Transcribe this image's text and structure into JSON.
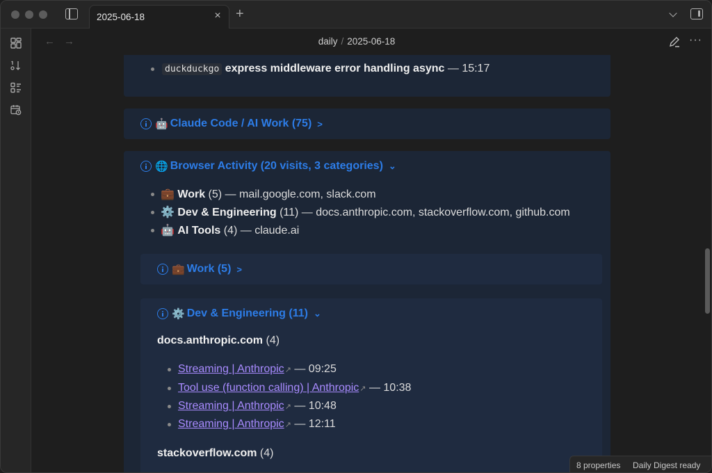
{
  "tab": {
    "title": "2025-06-18"
  },
  "breadcrumb": {
    "folder": "daily",
    "sep": "/",
    "file": "2025-06-18"
  },
  "top_item": {
    "code": "duckduckgo",
    "query": "express middleware error handling async",
    "time": " — 15:17"
  },
  "claude_callout": {
    "emoji": "🤖",
    "title": "Claude Code / AI Work (75)"
  },
  "browser_callout": {
    "emoji": "🌐",
    "title": "Browser Activity (20 visits, 3 categories)",
    "items": [
      {
        "emoji": "💼",
        "name": "Work",
        "count": "(5)",
        "rest": " — mail.google.com, slack.com"
      },
      {
        "emoji": "⚙️",
        "name": "Dev & Engineering",
        "count": "(11)",
        "rest": " — docs.anthropic.com, stackoverflow.com, github.com"
      },
      {
        "emoji": "🤖",
        "name": "AI Tools",
        "count": "(4)",
        "rest": " — claude.ai"
      }
    ]
  },
  "work_callout": {
    "emoji": "💼",
    "title": "Work (5)"
  },
  "dev_callout": {
    "emoji": "⚙️",
    "title": "Dev & Engineering (11)",
    "domain1": {
      "name": "docs.anthropic.com",
      "count": "(4)"
    },
    "links": [
      {
        "text": "Streaming | Anthropic",
        "time": " — 09:25"
      },
      {
        "text": "Tool use (function calling) | Anthropic",
        "time": " — 10:38"
      },
      {
        "text": "Streaming | Anthropic",
        "time": " — 10:48"
      },
      {
        "text": "Streaming | Anthropic",
        "time": " — 12:11"
      }
    ],
    "domain2": {
      "name": "stackoverflow.com",
      "count": "(4)"
    }
  },
  "status": {
    "properties": "8 properties",
    "digest": "Daily Digest ready"
  }
}
